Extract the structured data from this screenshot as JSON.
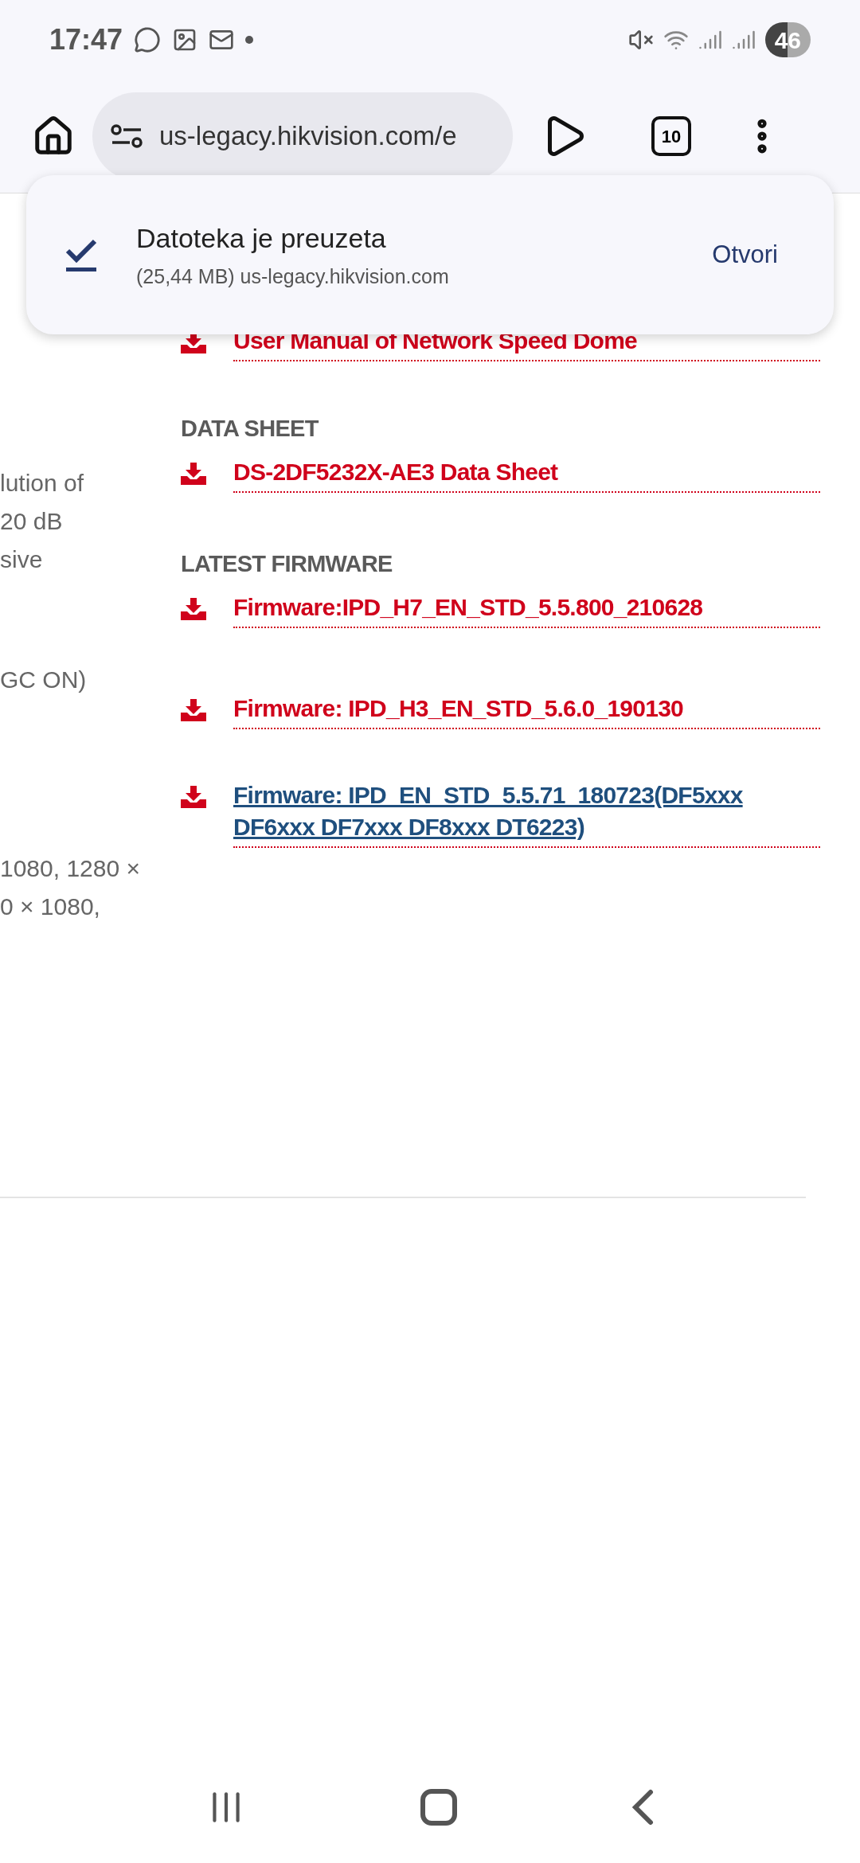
{
  "status_bar": {
    "time": "17:47",
    "battery": "46"
  },
  "toolbar": {
    "url": "us-legacy.hikvision.com/e",
    "tab_count": "10"
  },
  "download_toast": {
    "title": "Datoteka je preuzeta",
    "detail": "(25,44 MB) us-legacy.hikvision.com",
    "action": "Otvori"
  },
  "left_column_fragments": [
    {
      "lines": [
        "lution of",
        "20 dB",
        "sive"
      ]
    },
    {
      "lines": [
        "GC ON)"
      ]
    },
    {
      "lines": [
        "1080, 1280 ×",
        "0 × 1080,"
      ]
    }
  ],
  "sections": [
    {
      "links": [
        {
          "text": "User Manual of Network Speed Dome",
          "visited": false
        }
      ]
    },
    {
      "heading": "DATA SHEET",
      "links": [
        {
          "text": "DS-2DF5232X-AE3 Data Sheet",
          "visited": false
        }
      ]
    },
    {
      "heading": "LATEST FIRMWARE",
      "links": [
        {
          "text": "Firmware:IPD_H7_EN_STD_5.5.800_210628",
          "visited": false
        },
        {
          "text": "Firmware: IPD_H3_EN_STD_5.6.0_190130",
          "visited": false
        },
        {
          "text": "Firmware: IPD_EN_STD_5.5.71_180723(DF5xxx DF6xxx DF7xxx DF8xxx DT6223)",
          "visited": true
        }
      ]
    }
  ]
}
